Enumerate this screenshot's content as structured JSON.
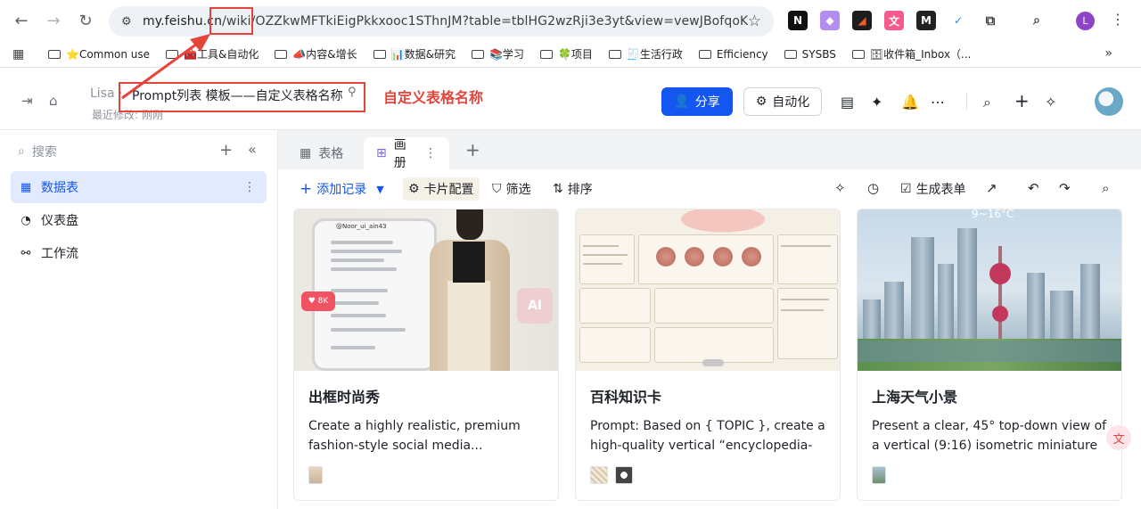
{
  "browser": {
    "url_host": "my.feishu.cn",
    "url_rest": "/wiki/OZZkwMFTkiEigPkkxooc1SThnJM?table=tblHG2wzRji3e3yt&view=vewJBofqoK",
    "profile_initial": "L",
    "extensions": [
      "N",
      "◆",
      "◢",
      "文",
      "M",
      "✓"
    ]
  },
  "bookmarks": [
    "⭐Common use",
    "🧰工具&自动化",
    "📣内容&增长",
    "📊数据&研究",
    "📚学习",
    "🍀项目",
    "🧾生活行政",
    "Efficiency",
    "SYSBS",
    "🗄收件箱_Inbox（..."
  ],
  "header": {
    "user": "Lisa",
    "title": "Prompt列表 模板——自定义表格名称",
    "last_modified": "最近修改: 刚刚",
    "annotation": "自定义表格名称",
    "share_label": "分享",
    "automation_label": "自动化"
  },
  "sidebar": {
    "search_placeholder": "搜索",
    "items": [
      {
        "label": "数据表",
        "icon": "table-icon",
        "active": true
      },
      {
        "label": "仪表盘",
        "icon": "dashboard-icon",
        "active": false
      },
      {
        "label": "工作流",
        "icon": "workflow-icon",
        "active": false
      }
    ]
  },
  "tabs": [
    {
      "label": "表格",
      "active": false
    },
    {
      "label": "画册",
      "active": true
    }
  ],
  "toolbar": {
    "add_record": "添加记录",
    "card_config": "卡片配置",
    "filter": "筛选",
    "sort": "排序",
    "generate_form": "生成表单"
  },
  "cards": [
    {
      "title": "出框时尚秀",
      "desc": "Create a highly realistic, premium fashion-style social media...",
      "handle": "@Noor_ui_ain43",
      "likes": "8K",
      "ai_badge": "AI"
    },
    {
      "title": "百科知识卡",
      "desc": "Prompt: Based on { TOPIC }, create a high-quality vertical “encyclopedia-styl..."
    },
    {
      "title": "上海天气小景",
      "desc": "Present a clear, 45° top-down view of a vertical (9:16) isometric miniature 3D...",
      "temp": "9~16°C"
    }
  ],
  "colors": {
    "accent": "#1456f0",
    "annotation": "#e5443b"
  }
}
